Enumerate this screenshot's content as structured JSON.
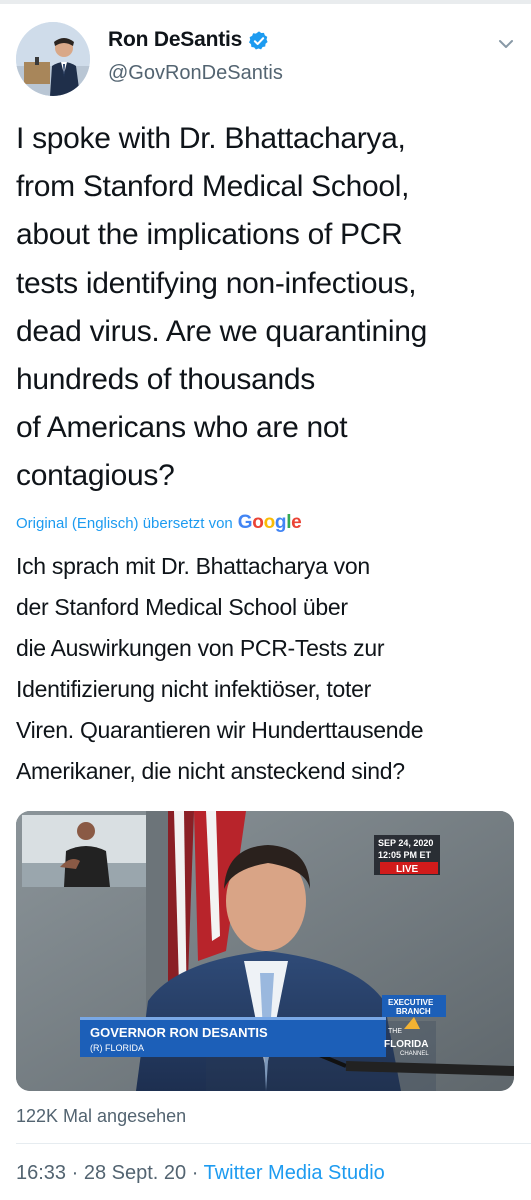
{
  "author": {
    "display_name": "Ron DeSantis",
    "handle": "@GovRonDeSantis",
    "verified": true
  },
  "icons": {
    "verified": "verified-badge-icon",
    "more": "chevron-down-icon"
  },
  "tweet": {
    "text_lines": [
      "I spoke with Dr. Bhattacharya,",
      "from Stanford Medical School,",
      "about the implications of PCR",
      "tests identifying non-infectious,",
      "dead virus. Are we quarantining",
      "hundreds of thousands",
      "of Americans who are not",
      "contagious?"
    ],
    "translation_label": "Original (Englisch) übersetzt von",
    "translation_provider": "Google",
    "translated_lines": [
      "Ich sprach mit Dr. Bhattacharya von",
      "der Stanford Medical School über",
      "die Auswirkungen von PCR-Tests zur",
      "Identifizierung nicht infektiöser, toter",
      "Viren. Quarantieren wir Hunderttausende",
      "Amerikaner, die nicht ansteckend sind?"
    ]
  },
  "media": {
    "date": "SEP 24, 2020",
    "time": "12:05 PM ET",
    "live_badge": "LIVE",
    "lower_third_name": "GOVERNOR RON DESANTIS",
    "lower_third_sub": "(R) FLORIDA",
    "branch_label_1": "EXECUTIVE",
    "branch_label_2": "BRANCH",
    "channel_the": "THE",
    "channel_name": "FLORIDA",
    "channel_sub": "CHANNEL"
  },
  "stats": {
    "views": "122K Mal angesehen"
  },
  "meta": {
    "time": "16:33",
    "sep1": " · ",
    "date": "28 Sept. 20",
    "sep2": " · ",
    "source": "Twitter Media Studio"
  },
  "colors": {
    "accent": "#1d9bf0",
    "secondary_text": "#536471",
    "live_red": "#d11b1b",
    "lower_third_blue": "#1c5fb8"
  }
}
